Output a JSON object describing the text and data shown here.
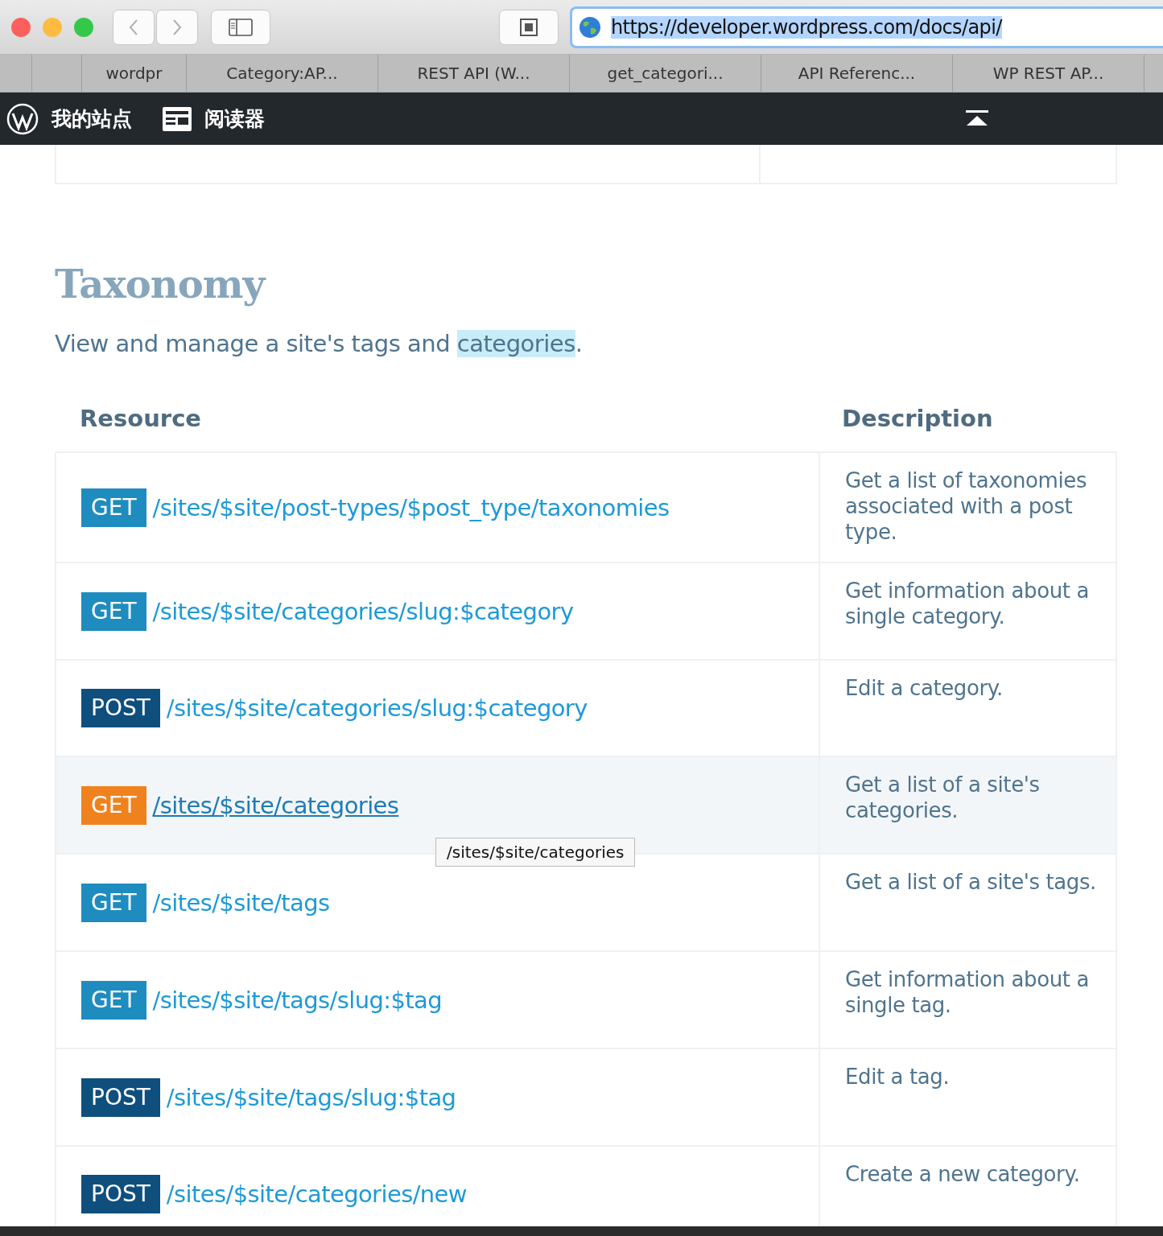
{
  "browser": {
    "url": "https://developer.wordpress.com/docs/api/",
    "url_selected": true,
    "tabs": [
      {
        "selected": false
      },
      {
        "selected": false
      },
      {
        "label": "wordpr",
        "selected": false
      },
      {
        "label": "Category:AP...",
        "selected": false
      },
      {
        "label": "REST API (W...",
        "selected": false
      },
      {
        "label": "get_categori...",
        "selected": false
      },
      {
        "label": "API Referenc...",
        "selected": false
      },
      {
        "label": "WP REST AP...",
        "selected": false
      }
    ]
  },
  "admin_bar": {
    "items": [
      {
        "kind": "logo",
        "label": "我的站点"
      },
      {
        "kind": "reader",
        "label": "阅读器"
      }
    ]
  },
  "section": {
    "title": "Taxonomy",
    "subtitle": {
      "before": "View and manage a site's tags and ",
      "highlighted": "categories",
      "after": "."
    },
    "table": {
      "columns": [
        "Resource",
        "Description"
      ],
      "rows": [
        {
          "method": "GET",
          "path": "/sites/$site/post-types/$post_type/taxonomies",
          "description": "Get a list of taxonomies associated with a post type.",
          "hovered": false
        },
        {
          "method": "GET",
          "path": "/sites/$site/categories/slug:$category",
          "description": "Get information about a single category.",
          "hovered": false
        },
        {
          "method": "POST",
          "path": "/sites/$site/categories/slug:$category",
          "description": "Edit a category.",
          "hovered": false
        },
        {
          "method": "GET",
          "path": "/sites/$site/categories",
          "description": "Get a list of a site's categories.",
          "hovered": true
        },
        {
          "method": "GET",
          "path": "/sites/$site/tags",
          "description": "Get a list of a site's tags.",
          "hovered": false
        },
        {
          "method": "GET",
          "path": "/sites/$site/tags/slug:$tag",
          "description": "Get information about a single tag.",
          "hovered": false
        },
        {
          "method": "POST",
          "path": "/sites/$site/tags/slug:$tag",
          "description": "Edit a tag.",
          "hovered": false
        },
        {
          "method": "POST",
          "path": "/sites/$site/categories/new",
          "description": "Create a new category.",
          "hovered": false
        }
      ]
    }
  },
  "tooltip": "/sites/$site/categories"
}
